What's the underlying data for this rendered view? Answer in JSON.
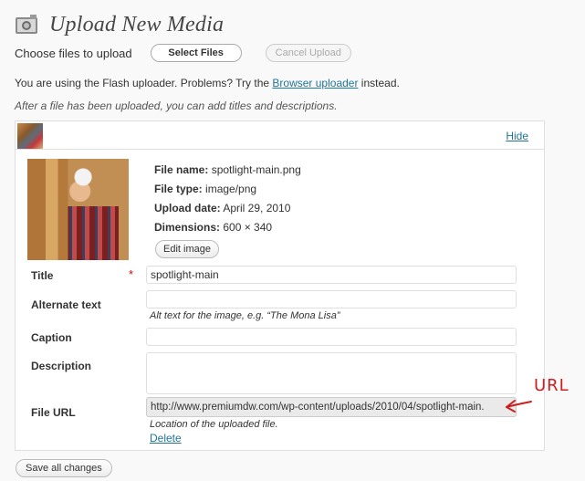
{
  "header": {
    "title": "Upload New Media",
    "icon": "media-upload-icon"
  },
  "upload": {
    "choose_label": "Choose files to upload",
    "select_button": "Select Files",
    "cancel_button": "Cancel Upload"
  },
  "notes": {
    "flash_prefix": "You are using the Flash uploader.  Problems?  Try the ",
    "browser_link": "Browser uploader",
    "flash_suffix": " instead.",
    "after_upload": "After a file has been uploaded, you can add titles and descriptions."
  },
  "item": {
    "hide_link": "Hide",
    "file_name_label": "File name:",
    "file_name": "spotlight-main.png",
    "file_type_label": "File type:",
    "file_type": "image/png",
    "upload_date_label": "Upload date:",
    "upload_date": "April 29, 2010",
    "dimensions_label": "Dimensions:",
    "dimensions": "600 × 340",
    "edit_button": "Edit image"
  },
  "fields": {
    "title_label": "Title",
    "required_mark": "*",
    "title_value": "spotlight-main",
    "alt_label": "Alternate text",
    "alt_value": "",
    "alt_help": "Alt text for the image, e.g. “The Mona Lisa”",
    "caption_label": "Caption",
    "caption_value": "",
    "description_label": "Description",
    "description_value": "",
    "url_label": "File URL",
    "url_value": "http://www.premiumdw.com/wp-content/uploads/2010/04/spotlight-main.",
    "url_help": "Location of the uploaded file.",
    "delete_link": "Delete"
  },
  "annotation": {
    "label": "URL",
    "color": "#cc1f1f"
  },
  "footer": {
    "save_button": "Save all changes"
  },
  "colors": {
    "link": "#21759b",
    "required": "#dd0000"
  }
}
